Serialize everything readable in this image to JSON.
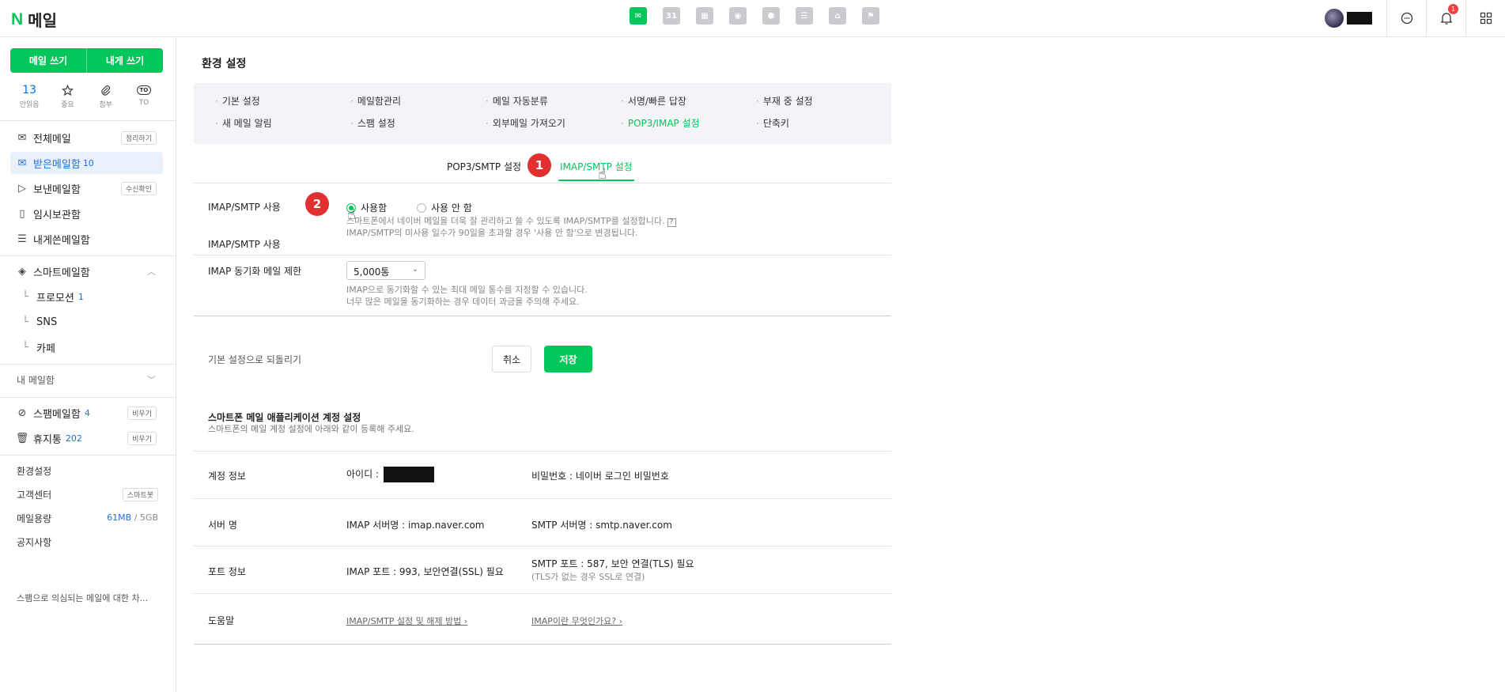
{
  "header": {
    "logo_mark": "N",
    "app_title": "메일",
    "calendar_day": "31",
    "notification_count": "1",
    "app_icons": [
      "mail-app-icon",
      "calendar-app-icon",
      "photo-app-icon",
      "contacts-app-icon",
      "cloud-app-icon",
      "memo-app-icon",
      "cafe-app-icon",
      "bookmark-app-icon"
    ]
  },
  "sidebar": {
    "write_mail": "메일 쓰기",
    "write_self": "내게 쓰기",
    "quick": [
      {
        "top": "13",
        "label": "안읽음"
      },
      {
        "top": "",
        "label": "중요",
        "icon": "star-icon"
      },
      {
        "top": "",
        "label": "첨부",
        "icon": "paperclip-icon"
      },
      {
        "top": "TO",
        "label": "TO",
        "icon": "to-icon"
      }
    ],
    "folders": {
      "all": {
        "label": "전체메일",
        "action": "정리하기"
      },
      "inbox": {
        "label": "받은메일함",
        "count": "10"
      },
      "sent": {
        "label": "보낸메일함",
        "action": "수신확인"
      },
      "drafts": {
        "label": "임시보관함"
      },
      "self": {
        "label": "내게쓴메일함"
      },
      "smart": {
        "label": "스마트메일함"
      },
      "promotion": {
        "label": "프로모션",
        "count": "1"
      },
      "sns": {
        "label": "SNS"
      },
      "cafe": {
        "label": "카페"
      },
      "my": {
        "label": "내 메일함"
      },
      "spam": {
        "label": "스팸메일함",
        "count": "4",
        "action": "비우기"
      },
      "trash": {
        "label": "휴지통",
        "count": "202",
        "action": "비우기"
      }
    },
    "settings": "환경설정",
    "support": {
      "label": "고객센터",
      "action": "스마트봇"
    },
    "storage": {
      "label": "메일용량",
      "used": "61MB",
      "sep": "/",
      "total": "5GB"
    },
    "notice": {
      "label": "공지사항",
      "text": "스팸으로 의심되는 메일에 대한 차..."
    }
  },
  "main": {
    "title": "환경 설정",
    "menu": [
      "기본 설정",
      "메일함관리",
      "메일 자동분류",
      "서명/빠른 답장",
      "부재 중 설정",
      "새 메일 알림",
      "스팸 설정",
      "외부메일 가져오기",
      "POP3/IMAP 설정",
      "단축키"
    ],
    "tabs": {
      "pop3": "POP3/SMTP 설정",
      "imap": "IMAP/SMTP 설정"
    },
    "steps": {
      "one": "1",
      "two": "2"
    },
    "imap_use": {
      "label": "IMAP/SMTP 사용",
      "on": "사용함",
      "off": "사용 안 함",
      "selected": "on",
      "desc1": "스마트폰에서 네이버 메일을 더욱 잘 관리하고 쓸 수 있도록 IMAP/SMTP를 설정합니다.",
      "help": "?",
      "desc2": "IMAP/SMTP의 미사용 일수가 90일을 초과할 경우 '사용 안 함'으로 변경됩니다."
    },
    "sync": {
      "label": "IMAP 동기화 메일 제한",
      "value": "5,000통",
      "desc1": "IMAP으로 동기화할 수 있는 최대 메일 통수를 지정할 수 있습니다.",
      "desc2": "너무 많은 메일을 동기화하는 경우 데이터 과금을 주의해 주세요."
    },
    "reset": "기본 설정으로 되돌리기",
    "cancel": "취소",
    "save": "저장",
    "phone": {
      "title": "스마트폰 메일 애플리케이션 계정 설정",
      "desc": "스마트폰의 메일 계정 설정에 아래와 같이 등록해 주세요.",
      "rows": {
        "account": {
          "label": "계정 정보",
          "c1": "아이디 : ",
          "c2": "비밀번호 : 네이버 로그인 비밀번호"
        },
        "server": {
          "label": "서버 명",
          "c1": "IMAP 서버명 : imap.naver.com",
          "c2": "SMTP 서버명 : smtp.naver.com"
        },
        "port": {
          "label": "포트 정보",
          "c1": "IMAP 포트 : 993, 보안연결(SSL) 필요",
          "c2": "SMTP 포트 : 587, 보안 연결(TLS) 필요",
          "c2_sub": "(TLS가 없는 경우 SSL로 연결)"
        },
        "help": {
          "label": "도움말",
          "c1": "IMAP/SMTP 설정 및 해제 방법 ›",
          "c2": "IMAP이란 무엇인가요? ›"
        }
      }
    }
  },
  "colors": {
    "accent": "#03c75a",
    "link": "#1f6fd9",
    "step": "#e03030"
  }
}
